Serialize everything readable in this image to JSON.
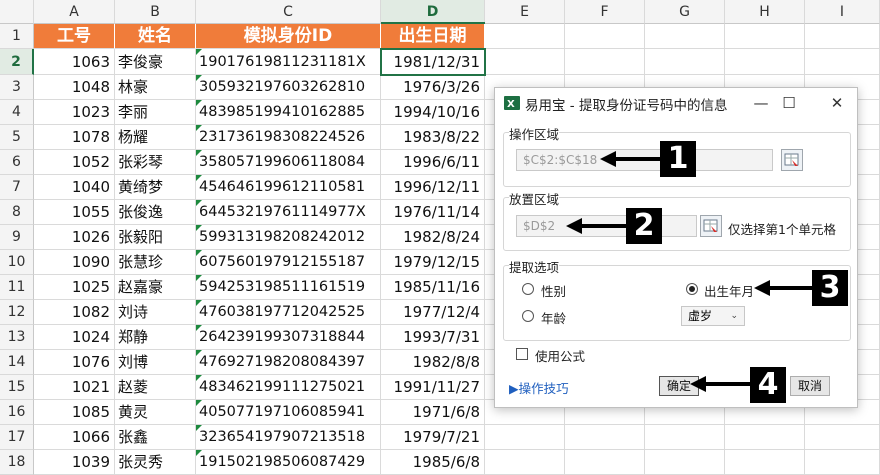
{
  "columns": [
    "A",
    "B",
    "C",
    "D",
    "E",
    "F",
    "G",
    "H",
    "I"
  ],
  "header_row": [
    "工号",
    "姓名",
    "模拟身份ID",
    "出生日期"
  ],
  "rows": [
    {
      "id": "1063",
      "name": "李俊豪",
      "idno": "19017619811231181X",
      "date": "1981/12/31"
    },
    {
      "id": "1048",
      "name": "林豪",
      "idno": "305932197603262810",
      "date": "1976/3/26"
    },
    {
      "id": "1023",
      "name": "李丽",
      "idno": "483985199410162885",
      "date": "1994/10/16"
    },
    {
      "id": "1078",
      "name": "杨耀",
      "idno": "231736198308224526",
      "date": "1983/8/22"
    },
    {
      "id": "1052",
      "name": "张彩琴",
      "idno": "358057199606118084",
      "date": "1996/6/11"
    },
    {
      "id": "1040",
      "name": "黄绮梦",
      "idno": "454646199612110581",
      "date": "1996/12/11"
    },
    {
      "id": "1055",
      "name": "张俊逸",
      "idno": "64453219761114977X",
      "date": "1976/11/14"
    },
    {
      "id": "1026",
      "name": "张毅阳",
      "idno": "599313198208242012",
      "date": "1982/8/24"
    },
    {
      "id": "1090",
      "name": "张慧珍",
      "idno": "607560197912155187",
      "date": "1979/12/15"
    },
    {
      "id": "1025",
      "name": "赵嘉豪",
      "idno": "594253198511161519",
      "date": "1985/11/16"
    },
    {
      "id": "1082",
      "name": "刘诗",
      "idno": "476038197712042525",
      "date": "1977/12/4"
    },
    {
      "id": "1024",
      "name": "郑静",
      "idno": "264239199307318844",
      "date": "1993/7/31"
    },
    {
      "id": "1076",
      "name": "刘博",
      "idno": "476927198208084397",
      "date": "1982/8/8"
    },
    {
      "id": "1021",
      "name": "赵菱",
      "idno": "483462199111275021",
      "date": "1991/11/27"
    },
    {
      "id": "1085",
      "name": "黄灵",
      "idno": "405077197106085941",
      "date": "1971/6/8"
    },
    {
      "id": "1066",
      "name": "张鑫",
      "idno": "323654197907213518",
      "date": "1979/7/21"
    },
    {
      "id": "1039",
      "name": "张灵秀",
      "idno": "191502198506087429",
      "date": "1985/6/8"
    }
  ],
  "dialog": {
    "title": "易用宝 - 提取身份证号码中的信息",
    "op_area_label": "操作区域",
    "op_area_value": "$C$2:$C$18",
    "place_area_label": "放置区域",
    "place_area_value": "$D$2",
    "place_hint": "仅选择第1个单元格",
    "options_label": "提取选项",
    "opt_gender": "性别",
    "opt_birth": "出生年月",
    "opt_age": "年龄",
    "age_select": "虚岁",
    "use_formula": "使用公式",
    "tips_link": "▶操作技巧",
    "ok": "确定",
    "cancel": "取消"
  },
  "callouts": [
    "1",
    "2",
    "3",
    "4"
  ],
  "colors": {
    "header_bg": "#f07c3a",
    "accent_green": "#217346"
  }
}
